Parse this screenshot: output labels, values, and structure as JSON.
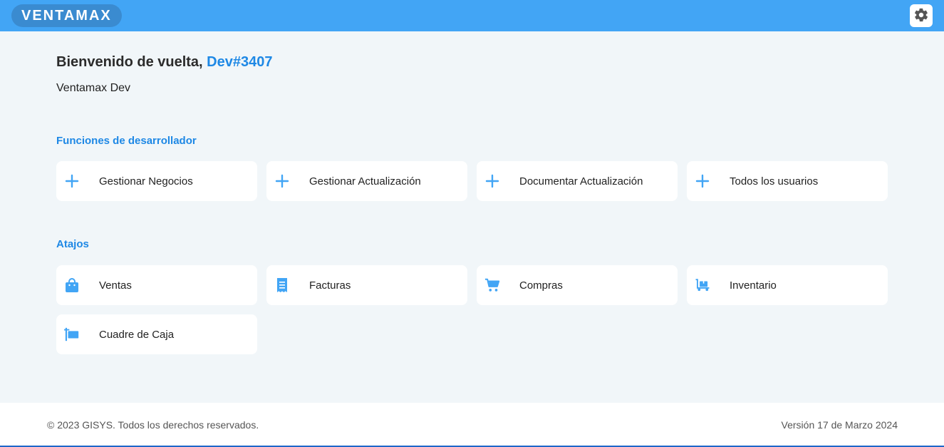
{
  "header": {
    "logo": "VENTAMAX",
    "settings_icon": "gear-icon",
    "accent_color": "#42a5f5"
  },
  "welcome": {
    "greeting": "Bienvenido de vuelta,",
    "username": "Dev#3407",
    "company": "Ventamax Dev"
  },
  "dev_section": {
    "title": "Funciones de desarrollador",
    "items": [
      {
        "label": "Gestionar Negocios",
        "icon": "plus-icon"
      },
      {
        "label": "Gestionar Actualización",
        "icon": "plus-icon"
      },
      {
        "label": "Documentar Actualización",
        "icon": "plus-icon"
      },
      {
        "label": "Todos los usuarios",
        "icon": "plus-icon"
      }
    ]
  },
  "shortcuts": {
    "title": "Atajos",
    "items": [
      {
        "label": "Ventas",
        "icon": "shopping-bag-icon"
      },
      {
        "label": "Facturas",
        "icon": "receipt-icon"
      },
      {
        "label": "Compras",
        "icon": "shopping-cart-icon"
      },
      {
        "label": "Inventario",
        "icon": "dolly-icon"
      },
      {
        "label": "Cuadre de Caja",
        "icon": "cash-register-icon"
      }
    ]
  },
  "footer": {
    "copyright": "© 2023 GISYS. Todos los derechos reservados.",
    "version": "Versión 17 de Marzo 2024"
  }
}
